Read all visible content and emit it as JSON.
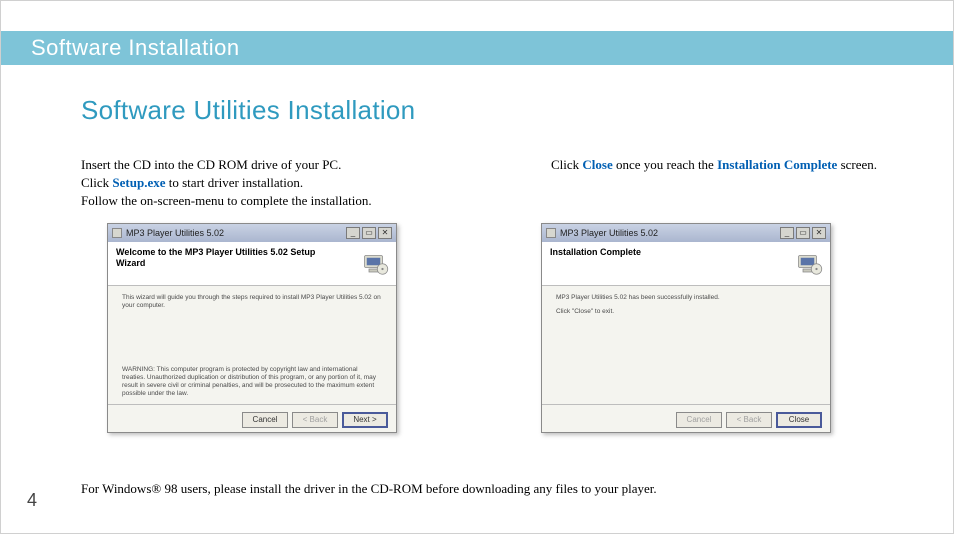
{
  "banner": {
    "title": "Software Installation"
  },
  "page": {
    "title": "Software Utilities Installation",
    "number": "4",
    "footnote": "For Windows® 98 users, please install the driver in the CD-ROM before downloading any files to your player."
  },
  "left_instruction": {
    "line1": "Insert the CD into the CD ROM drive of your PC.",
    "line2a": "Click ",
    "setup": "Setup.exe",
    "line2b": " to start driver installation.",
    "line3": "Follow the on-screen-menu to complete the installation."
  },
  "right_instruction": {
    "a": "Click ",
    "close": "Close",
    "b": " once you reach the ",
    "complete": "Installation Complete",
    "c": " screen."
  },
  "wizard_left": {
    "titlebar": "MP3 Player Utilities 5.02",
    "header": "Welcome to the MP3 Player Utilities 5.02 Setup Wizard",
    "body_top": "This wizard will guide you through the steps required to install MP3 Player Utilities 5.02 on your computer.",
    "body_bottom": "WARNING: This computer program is protected by copyright law and international treaties. Unauthorized duplication or distribution of this program, or any portion of it, may result in severe civil or criminal penalties, and will be prosecuted to the maximum extent possible under the law.",
    "btn_cancel": "Cancel",
    "btn_back": "< Back",
    "btn_next": "Next >"
  },
  "wizard_right": {
    "titlebar": "MP3 Player Utilities 5.02",
    "header": "Installation Complete",
    "body_line1": "MP3 Player Utilities 5.02 has been successfully installed.",
    "body_line2": "Click \"Close\" to exit.",
    "btn_cancel": "Cancel",
    "btn_back": "< Back",
    "btn_close": "Close"
  },
  "win_controls": {
    "min": "_",
    "max": "▭",
    "close": "✕"
  }
}
